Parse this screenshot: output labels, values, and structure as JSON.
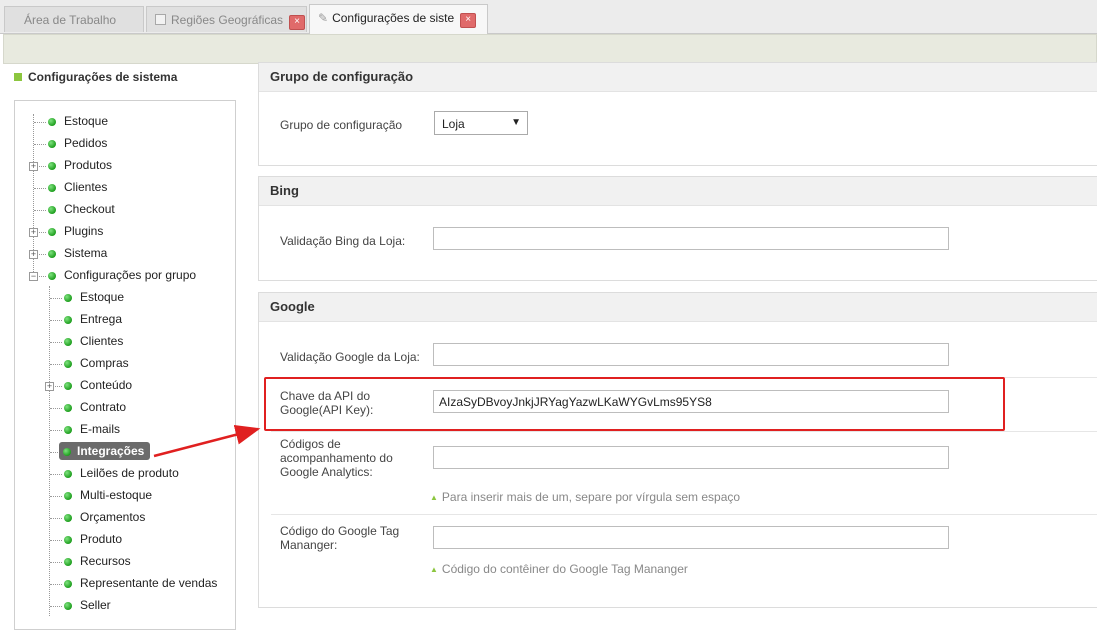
{
  "tabs": [
    {
      "label": "Área de Trabalho"
    },
    {
      "label": "Regiões Geográficas",
      "close": "×"
    },
    {
      "label": "Configurações de siste",
      "close": "×"
    }
  ],
  "sidebar": {
    "title": "Configurações de sistema",
    "items": [
      {
        "label": "Estoque"
      },
      {
        "label": "Pedidos"
      },
      {
        "label": "Produtos"
      },
      {
        "label": "Clientes"
      },
      {
        "label": "Checkout"
      },
      {
        "label": "Plugins"
      },
      {
        "label": "Sistema"
      },
      {
        "label": "Configurações por grupo"
      }
    ],
    "subitems": [
      {
        "label": "Estoque"
      },
      {
        "label": "Entrega"
      },
      {
        "label": "Clientes"
      },
      {
        "label": "Compras"
      },
      {
        "label": "Conteúdo"
      },
      {
        "label": "Contrato"
      },
      {
        "label": "E-mails"
      },
      {
        "label": "Integrações"
      },
      {
        "label": "Leilões de produto"
      },
      {
        "label": "Multi-estoque"
      },
      {
        "label": "Orçamentos"
      },
      {
        "label": "Produto"
      },
      {
        "label": "Recursos"
      },
      {
        "label": "Representante de vendas"
      },
      {
        "label": "Seller"
      }
    ]
  },
  "config_group": {
    "title": "Grupo de configuração",
    "label": "Grupo de configuração",
    "selected": "Loja",
    "caret": "▼"
  },
  "bing": {
    "title": "Bing",
    "validation_label": "Validação Bing da Loja:",
    "validation_value": ""
  },
  "google": {
    "title": "Google",
    "validation_label": "Validação Google da Loja:",
    "validation_value": "",
    "api_key_label": "Chave da API do Google(API Key):",
    "api_key_value": "AIzaSyDBvoyJnkjJRYagYazwLKaWYGvLms95YS8",
    "analytics_label": "Códigos de acompanhamento do Google Analytics:",
    "analytics_value": "",
    "analytics_hint": "Para inserir mais de um, separe por vírgula sem espaço",
    "gtm_label": "Código do Google Tag Mananger:",
    "gtm_value": "",
    "gtm_hint": "Código do contêiner do Google Tag Mananger",
    "hint_icon": "▲"
  },
  "colors": {
    "annotation": "#e02020",
    "accent_green": "#8cc63f",
    "selected_bg": "#6b6b6b"
  }
}
